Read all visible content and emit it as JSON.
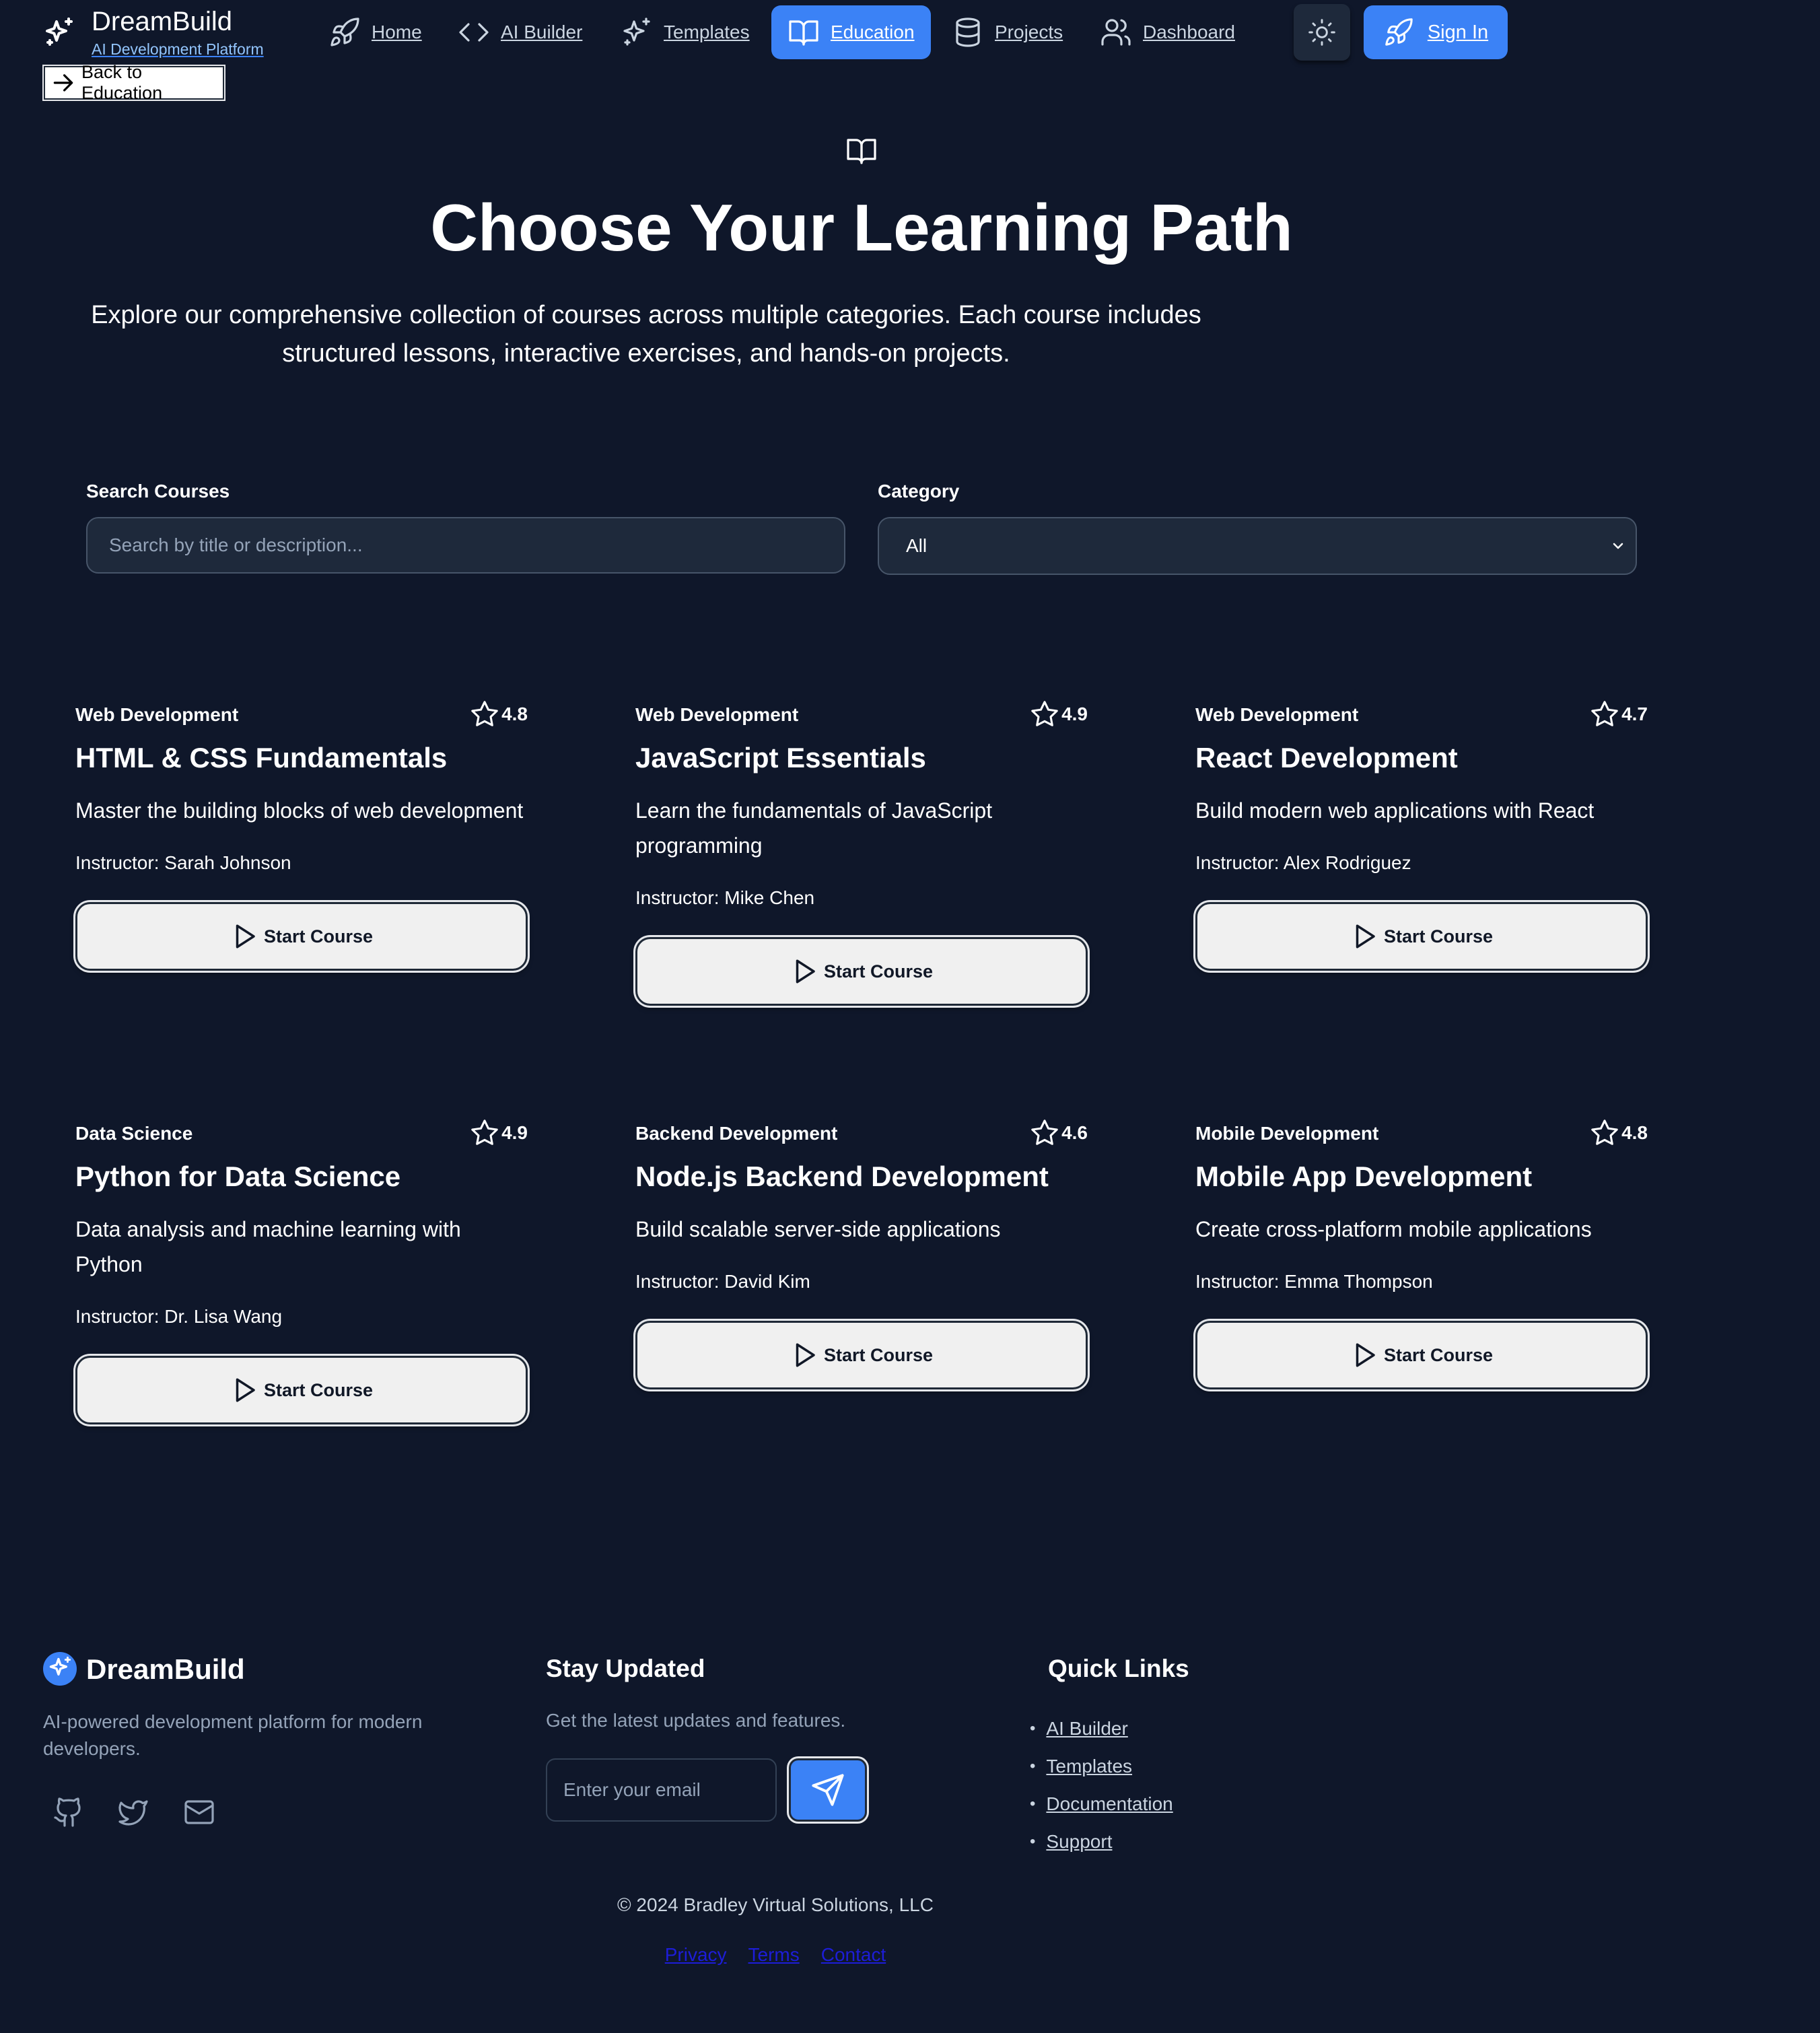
{
  "header": {
    "brand": "DreamBuild",
    "tagline": "AI Development Platform",
    "back_label": "Back to Education",
    "nav": [
      {
        "label": "Home",
        "icon": "rocket-icon"
      },
      {
        "label": "AI Builder",
        "icon": "code-icon"
      },
      {
        "label": "Templates",
        "icon": "sparkles-icon"
      },
      {
        "label": "Education",
        "icon": "book-icon",
        "active": true
      },
      {
        "label": "Projects",
        "icon": "database-icon"
      },
      {
        "label": "Dashboard",
        "icon": "users-icon"
      }
    ],
    "theme_icon": "sun-icon",
    "signin_label": "Sign In"
  },
  "hero": {
    "icon": "book-open-icon",
    "title": "Choose Your Learning Path",
    "description_line1": "Explore our comprehensive collection of courses across multiple categories. Each course includes",
    "description_line2": "structured lessons, interactive exercises, and hands-on projects."
  },
  "filters": {
    "search_label": "Search Courses",
    "search_placeholder": "Search by title or description...",
    "category_label": "Category",
    "category_value": "All"
  },
  "courses": [
    {
      "category": "Web Development",
      "rating": "4.8",
      "title": "HTML & CSS Fundamentals",
      "description": "Master the building blocks of web development",
      "instructor": "Instructor: Sarah Johnson",
      "button": "Start Course"
    },
    {
      "category": "Web Development",
      "rating": "4.9",
      "title": "JavaScript Essentials",
      "description": "Learn the fundamentals of JavaScript programming",
      "instructor": "Instructor: Mike Chen",
      "button": "Start Course"
    },
    {
      "category": "Web Development",
      "rating": "4.7",
      "title": "React Development",
      "description": "Build modern web applications with React",
      "instructor": "Instructor: Alex Rodriguez",
      "button": "Start Course"
    },
    {
      "category": "Data Science",
      "rating": "4.9",
      "title": "Python for Data Science",
      "description": "Data analysis and machine learning with Python",
      "instructor": "Instructor: Dr. Lisa Wang",
      "button": "Start Course"
    },
    {
      "category": "Backend Development",
      "rating": "4.6",
      "title": "Node.js Backend Development",
      "description": "Build scalable server-side applications",
      "instructor": "Instructor: David Kim",
      "button": "Start Course"
    },
    {
      "category": "Mobile Development",
      "rating": "4.8",
      "title": "Mobile App Development",
      "description": "Create cross-platform mobile applications",
      "instructor": "Instructor: Emma Thompson",
      "button": "Start Course"
    }
  ],
  "footer": {
    "brand": "DreamBuild",
    "description": "AI-powered development platform for modern developers.",
    "social_icons": [
      "github-icon",
      "twitter-icon",
      "mail-icon"
    ],
    "newsletter_heading": "Stay Updated",
    "newsletter_text": "Get the latest updates and features.",
    "email_placeholder": "Enter your email",
    "quick_links_heading": "Quick Links",
    "quick_links": [
      "AI Builder",
      "Templates",
      "Documentation",
      "Support"
    ],
    "copyright": "© 2024 Bradley Virtual Solutions, LLC",
    "legal": [
      "Privacy",
      "Terms",
      "Contact"
    ]
  },
  "colors": {
    "background": "#0f172a",
    "accent": "#3b82f6",
    "input_bg": "#1e293b",
    "button_light": "#f0f0f0"
  }
}
